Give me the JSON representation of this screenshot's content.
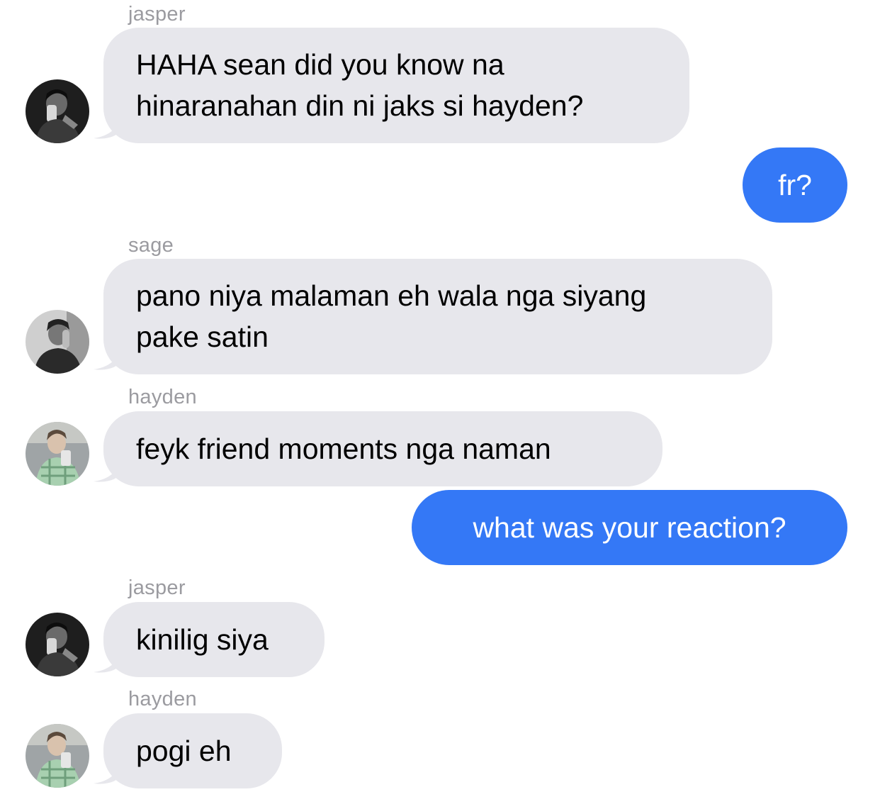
{
  "colors": {
    "incoming_bubble": "#e7e7ec",
    "outgoing_bubble": "#3478f6",
    "sender_label": "#9b9ba0"
  },
  "messages": [
    {
      "sender": "jasper",
      "lines": [
        "HAHA sean did you know na",
        "hinaranahan din ni jaks si hayden?"
      ],
      "avatar": "jasper-avatar"
    },
    {
      "outgoing": true,
      "lines": [
        "fr?"
      ]
    },
    {
      "sender": "sage",
      "lines": [
        "pano niya malaman eh wala nga siyang",
        "pake satin"
      ],
      "avatar": "sage-avatar"
    },
    {
      "sender": "hayden",
      "lines": [
        "feyk friend moments nga naman"
      ],
      "avatar": "hayden-avatar"
    },
    {
      "outgoing": true,
      "lines": [
        "what was your reaction?"
      ]
    },
    {
      "sender": "jasper",
      "lines": [
        "kinilig siya"
      ],
      "avatar": "jasper-avatar"
    },
    {
      "sender": "hayden",
      "lines": [
        "pogi eh"
      ],
      "avatar": "hayden-avatar"
    }
  ]
}
